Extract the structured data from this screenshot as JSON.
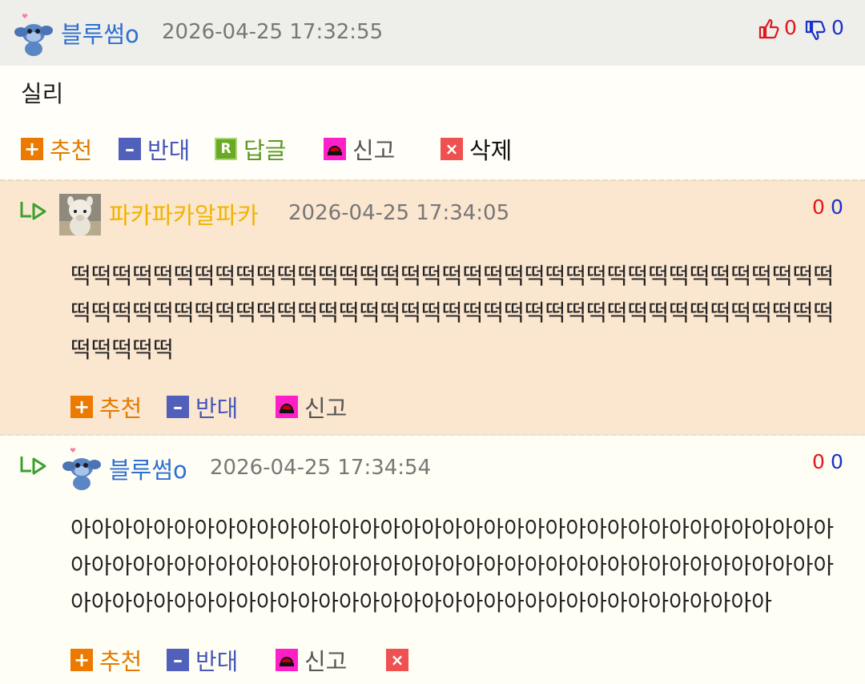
{
  "comments": [
    {
      "author": "블루썸o",
      "time": "2026-04-25 17:32:55",
      "text": "실리",
      "likes": "0",
      "dislikes": "0",
      "actions": {
        "recommend": "추천",
        "oppose": "반대",
        "reply": "답글",
        "report": "신고",
        "delete": "삭제"
      }
    },
    {
      "author": "파카파카알파카",
      "time": "2026-04-25 17:34:05",
      "text": "떡떡떡떡떡떡떡떡떡떡떡떡떡떡떡떡떡떡떡떡떡떡떡떡떡떡떡떡떡떡떡떡떡떡떡떡떡떡떡떡떡떡떡떡떡떡떡떡떡떡떡떡떡떡떡떡떡떡떡떡떡떡떡떡떡떡떡떡떡떡떡떡떡떡떡떡떡떡떡",
      "likes": "0",
      "dislikes": "0",
      "actions": {
        "recommend": "추천",
        "oppose": "반대",
        "report": "신고"
      }
    },
    {
      "author": "블루썸o",
      "time": "2026-04-25 17:34:54",
      "text": "아아아아아아아아아아아아아아아아아아아아아아아아아아아아아아아아아아아아아아아아아아아아아아아아아아아아아아아아아아아아아아아아아아아아아아아아아아아아아아아아아아아아아아아아아아아아아아아아아아아아아아아아아아아아",
      "likes": "0",
      "dislikes": "0",
      "actions": {
        "recommend": "추천",
        "oppose": "반대",
        "report": "신고"
      }
    }
  ],
  "icons": {
    "avatar_user": "stitch-avatar-icon",
    "avatar_alpaca": "alpaca-avatar-icon",
    "like": "thumbs-up-icon",
    "dislike": "thumbs-down-icon",
    "reply_arrow": "reply-arrow-icon"
  },
  "colors": {
    "author": "#2f6fd0",
    "author_alt": "#f0b400",
    "reply_bg": "#fbe6cf",
    "like": "#e0161c",
    "dislike": "#1832c8"
  }
}
